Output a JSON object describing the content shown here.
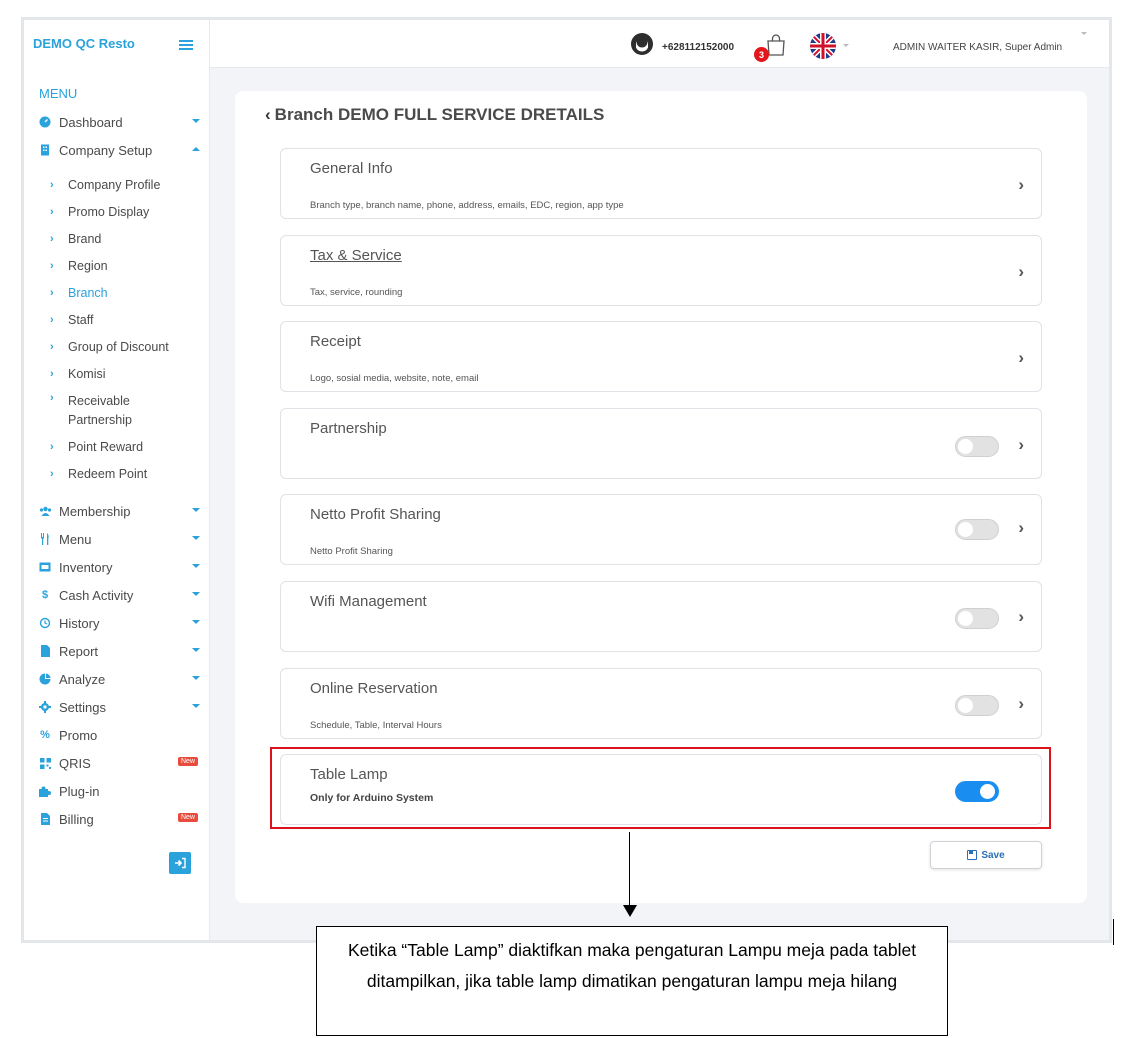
{
  "app": {
    "brand": "DEMO QC Resto",
    "menu_title": "MENU"
  },
  "header": {
    "phone": "+628112152000",
    "cart_count": "3",
    "user": "ADMIN WAITER KASIR, Super Admin"
  },
  "sidebar": {
    "items": [
      {
        "label": "Dashboard",
        "icon": "dashboard-icon"
      },
      {
        "label": "Company Setup",
        "icon": "building-icon"
      }
    ],
    "company_setup_children": [
      "Company Profile",
      "Promo Display",
      "Brand",
      "Region",
      "Branch",
      "Staff",
      "Group of Discount",
      "Komisi",
      "Receivable Partnership",
      "Point Reward",
      "Redeem Point"
    ],
    "more_items": [
      {
        "label": "Membership",
        "icon": "users-icon",
        "caret": true
      },
      {
        "label": "Menu",
        "icon": "utensils-icon",
        "caret": true
      },
      {
        "label": "Inventory",
        "icon": "box-icon",
        "caret": true
      },
      {
        "label": "Cash Activity",
        "icon": "dollar-icon",
        "caret": true
      },
      {
        "label": "History",
        "icon": "history-icon",
        "caret": true
      },
      {
        "label": "Report",
        "icon": "file-icon",
        "caret": true
      },
      {
        "label": "Analyze",
        "icon": "pie-chart-icon",
        "caret": true
      },
      {
        "label": "Settings",
        "icon": "gear-icon",
        "caret": true
      },
      {
        "label": "Promo",
        "icon": "percent-icon",
        "caret": false
      },
      {
        "label": "QRIS",
        "icon": "qr-icon",
        "caret": false,
        "badge": "New"
      },
      {
        "label": "Plug-in",
        "icon": "puzzle-icon",
        "caret": false
      },
      {
        "label": "Billing",
        "icon": "receipt-icon",
        "caret": false,
        "badge": "New"
      }
    ],
    "active_child": "Branch"
  },
  "main": {
    "back_glyph": "‹",
    "title": "Branch DEMO FULL SERVICE DRETAILS",
    "panels": [
      {
        "title": "General Info",
        "desc": "Branch type, branch name, phone, address, emails, EDC, region, app type"
      },
      {
        "title": "Tax & Service",
        "desc": "Tax, service, rounding"
      },
      {
        "title": "Receipt",
        "desc": "Logo, sosial media, website, note, email"
      },
      {
        "title": "Partnership",
        "desc": "",
        "toggle": false
      },
      {
        "title": "Netto Profit Sharing",
        "desc": "Netto Profit Sharing",
        "toggle": false
      },
      {
        "title": "Wifi Management",
        "desc": "",
        "toggle": false
      },
      {
        "title": "Online Reservation",
        "desc": "Schedule, Table, Interval Hours",
        "toggle": false
      },
      {
        "title": "Table Lamp",
        "desc": "Only for Arduino System",
        "toggle": true
      }
    ],
    "save_label": "Save"
  },
  "annotation": {
    "note": "Ketika “Table Lamp” diaktifkan maka pengaturan Lampu meja pada tablet ditampilkan, jika table lamp dimatikan pengaturan lampu meja hilang"
  },
  "colors": {
    "accent": "#2aa2dc",
    "toggle_on": "#1a8ef0",
    "highlight": "#d9141c",
    "badge": "#e74c3c"
  }
}
